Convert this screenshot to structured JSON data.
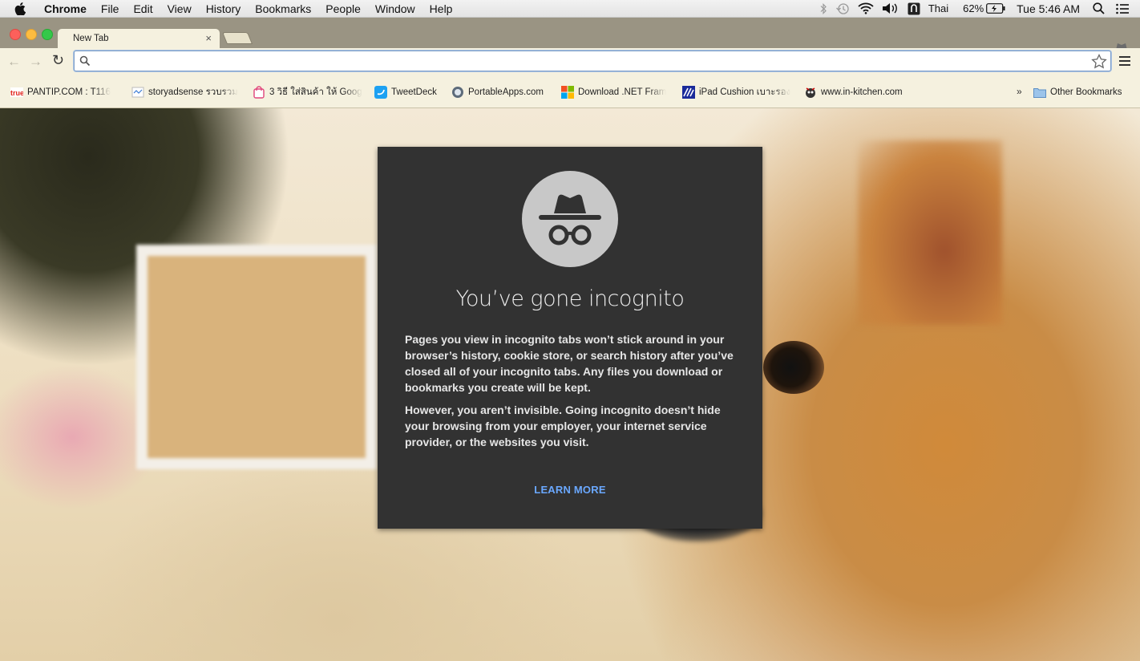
{
  "menubar": {
    "app_name": "Chrome",
    "items": [
      "File",
      "Edit",
      "View",
      "History",
      "Bookmarks",
      "People",
      "Window",
      "Help"
    ],
    "input_source": "Thai",
    "battery": "62%",
    "clock": "Tue 5:46 AM"
  },
  "tabs": {
    "active_title": "New Tab",
    "close_symbol": "×"
  },
  "toolbar": {
    "omnibox_value": "",
    "back_symbol": "←",
    "forward_symbol": "→",
    "reload_symbol": "↻"
  },
  "bookmarks": {
    "items": [
      {
        "label": "PANTIP.COM : T116",
        "icon": "truemove-favicon"
      },
      {
        "label": "storyadsense รวบรวม",
        "icon": "page-favicon"
      },
      {
        "label": "3 วิธี ใส่สินค้า ให้ Goog",
        "icon": "shopping-bag-favicon"
      },
      {
        "label": "TweetDeck",
        "icon": "tweetdeck-favicon"
      },
      {
        "label": "PortableApps.com",
        "icon": "portableapps-favicon"
      },
      {
        "label": "Download .NET Fram",
        "icon": "microsoft-favicon"
      },
      {
        "label": "iPad Cushion เบาะรอง",
        "icon": "nitro-favicon"
      },
      {
        "label": "www.in-kitchen.com",
        "icon": "kitchen-favicon"
      }
    ],
    "overflow_symbol": "»",
    "other_bookmarks": "Other Bookmarks"
  },
  "incognito": {
    "title": "You’ve gone incognito",
    "paragraph1": "Pages you view in incognito tabs won’t stick around in your browser’s history, cookie store, or search history after you’ve closed all of your incognito tabs. Any files you download or bookmarks you create will be kept.",
    "paragraph2": "However, you aren’t invisible. Going incognito doesn’t hide your browsing from your employer, your internet service provider, or the websites you visit.",
    "learn_more": "LEARN MORE"
  },
  "colors": {
    "card_bg": "#323232",
    "link": "#6aa8ff",
    "toolbar_bg": "#f5f1df",
    "tabstrip_bg": "#9a9483"
  }
}
